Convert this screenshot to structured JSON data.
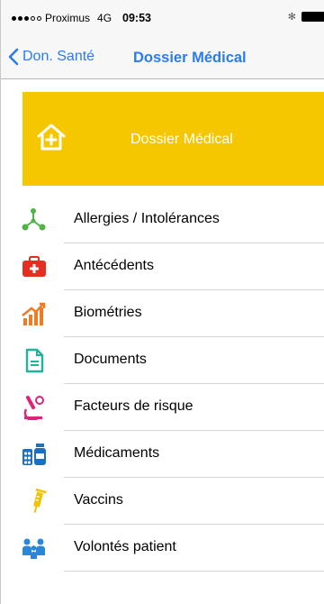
{
  "status_bar": {
    "carrier": "Proximus",
    "network": "4G",
    "time": "09:53",
    "bluetooth_symbol": "✻",
    "signal_bars_filled": 3,
    "signal_bars_total": 5
  },
  "nav": {
    "back_label": "Don. Santé",
    "title": "Dossier Médical"
  },
  "banner": {
    "title": "Dossier Médical",
    "icon": "home-medical-icon",
    "color": "#f5c700"
  },
  "menu": {
    "items": [
      {
        "label": "Allergies / Intolérances",
        "icon": "molecule-icon"
      },
      {
        "label": "Antécédents",
        "icon": "medical-kit-icon"
      },
      {
        "label": "Biométries",
        "icon": "growth-chart-icon"
      },
      {
        "label": "Documents",
        "icon": "document-icon"
      },
      {
        "label": "Facteurs de risque",
        "icon": "microscope-icon"
      },
      {
        "label": "Médicaments",
        "icon": "medication-icon"
      },
      {
        "label": "Vaccins",
        "icon": "syringe-icon"
      },
      {
        "label": "Volontés patient",
        "icon": "family-icon"
      }
    ]
  },
  "colors": {
    "accent": "#2b7bf0",
    "banner": "#f5c700",
    "separator": "#d4d4d4"
  }
}
